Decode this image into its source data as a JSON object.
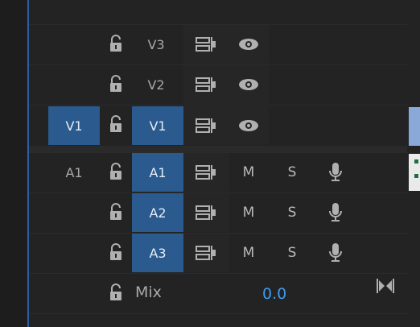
{
  "tracks": {
    "video": [
      {
        "label": "V3"
      },
      {
        "label": "V2"
      },
      {
        "label": "V1"
      }
    ],
    "source_video_label": "V1",
    "source_audio_label": "A1",
    "audio": [
      {
        "label": "A1",
        "mute": "M",
        "solo": "S"
      },
      {
        "label": "A2",
        "mute": "M",
        "solo": "S"
      },
      {
        "label": "A3",
        "mute": "M",
        "solo": "S"
      }
    ]
  },
  "mix": {
    "label": "Mix",
    "value": "0.0"
  },
  "colors": {
    "accent": "#3e9bf2",
    "active_chip": "#2b5a8e"
  },
  "icons": [
    "lock-icon",
    "sync-lock-icon",
    "eye-icon",
    "mic-icon",
    "fit-icon"
  ]
}
